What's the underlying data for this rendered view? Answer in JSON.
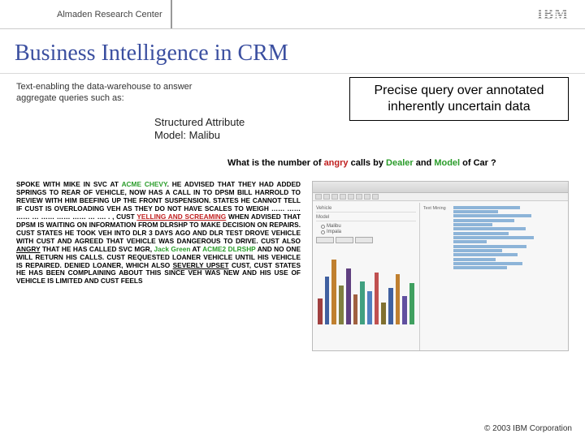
{
  "header": {
    "center_label": "Almaden Research Center",
    "logo": "IBM"
  },
  "title": "Business Intelligence in CRM",
  "subtext": "Text-enabling the data-warehouse to answer aggregate queries such as:",
  "structured": {
    "l1": "Structured Attribute",
    "l2": "Model: Malibu"
  },
  "precise": {
    "l1": "Precise query over annotated",
    "l2": "inherently uncertain data"
  },
  "question": {
    "p1": "What is the number of ",
    "angry": "angry",
    "p2": " calls by ",
    "dealer": "Dealer",
    "p3": " and ",
    "model": "Model",
    "p4": " of Car ?"
  },
  "call_text": {
    "s1": "SPOKE WITH MIKE IN SVC AT ",
    "g1": "ACME CHEVY",
    "s2": ". HE ADVISED THAT THEY HAD ADDED SPRINGS TO REAR OF VEHICLE, NOW HAS A CALL IN TO DPSM BILL HARROLD TO REVIEW WITH HIM BEEFING UP THE FRONT SUSPENSION. STATES HE CANNOT TELL IF CUST IS OVERLOADING VEH AS THEY DO NOT HAVE SCALES TO WEIGH …… …… …… … …… …… …… … …. . , CUST ",
    "r1": "YELLING AND SCREAMING",
    "s3": " WHEN ADVISED THAT DPSM IS WAITING ON INFORMATION FROM DLRSHP TO MAKE DECISION ON REPAIRS. CUST STATES HE TOOK VEH INTO DLR 3 DAYS AGO AND DLR TEST DROVE VEHICLE WITH CUST AND AGREED THAT VEHICLE WAS DANGEROUS TO DRIVE. CUST ALSO ",
    "u1": "ANGRY",
    "s4": " THAT HE HAS CALLED SVC MGR, ",
    "g2": "Jack Green",
    "s5": " AT ",
    "g3": "ACME2 DLRSHP",
    "s6": " AND NO ONE WILL RETURN HIS CALLS. CUST REQUESTED LOANER VEHICLE UNTIL HIS VEHICLE IS REPAIRED. DENIED LOANER, WHICH ALSO ",
    "u2": "SEVERLY UPSET",
    "s7": " CUST, CUST STATES HE HAS BEEN COMPLAINING ABOUT THIS SINCE VEH WAS NEW AND HIS USE OF VEHICLE IS LIMITED AND CUST FEELS"
  },
  "screenshot_labels": {
    "vehicle": "Vehicle",
    "model": "Model",
    "opt_malibu": "Malibu",
    "opt_impala": "Impala"
  },
  "chart_data": {
    "type": "bar",
    "note": "approximate heights; exact values not legible",
    "values": [
      30,
      55,
      75,
      45,
      65,
      35,
      50,
      38,
      60,
      25,
      42,
      58,
      33,
      48
    ],
    "colors": [
      "#a04040",
      "#4060a0",
      "#c08030",
      "#808040",
      "#604080",
      "#a06040",
      "#40a080",
      "#5080c0",
      "#c05050",
      "#807030",
      "#4060a0",
      "#c08030",
      "#6050a0",
      "#40a060"
    ]
  },
  "footer": "© 2003 IBM Corporation"
}
